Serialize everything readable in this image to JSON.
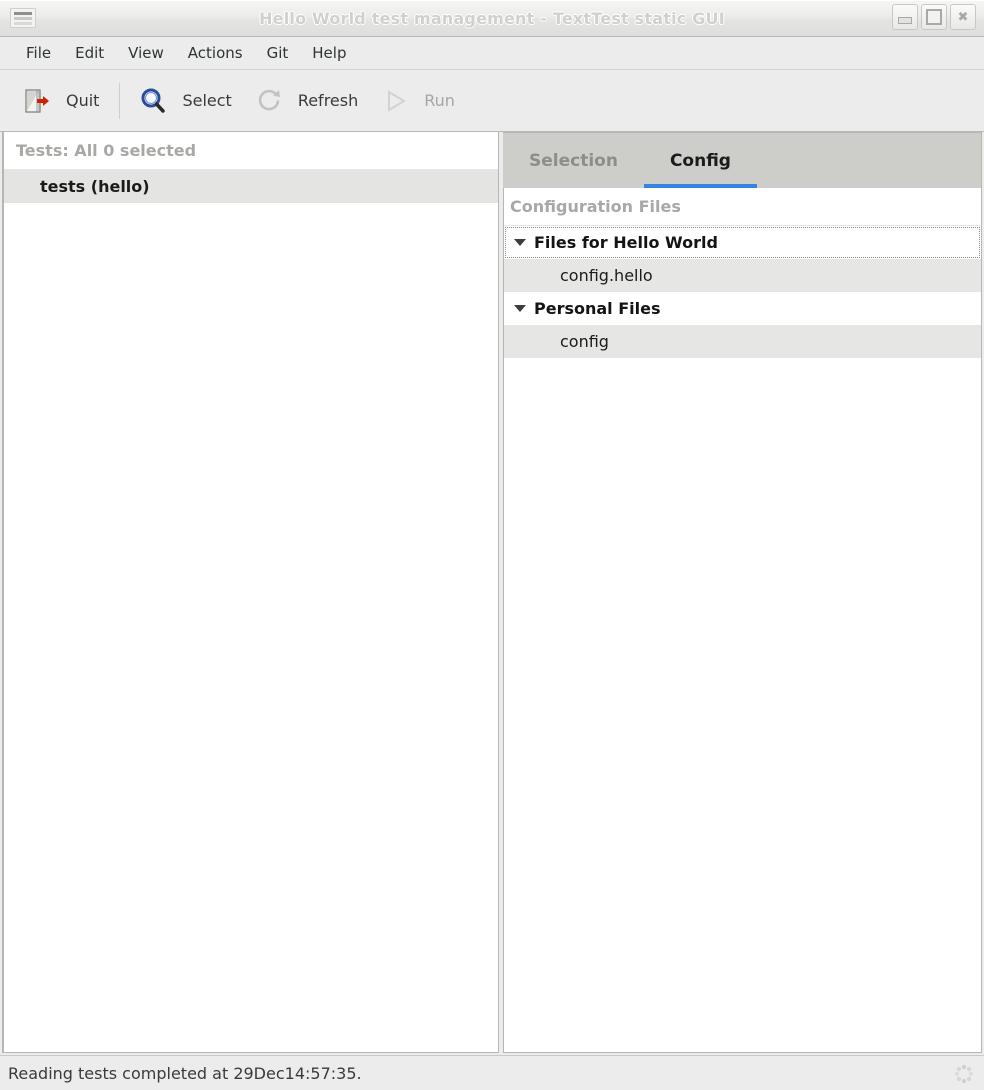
{
  "window": {
    "title": "Hello World test management - TextTest static GUI",
    "menu_icon": "window-menu-icon",
    "controls": {
      "minimize": "minimize-icon",
      "maximize": "maximize-icon",
      "close": "close-icon"
    }
  },
  "menubar": {
    "items": [
      {
        "label": "File"
      },
      {
        "label": "Edit"
      },
      {
        "label": "View"
      },
      {
        "label": "Actions"
      },
      {
        "label": "Git"
      },
      {
        "label": "Help"
      }
    ]
  },
  "toolbar": {
    "items": [
      {
        "label": "Quit",
        "icon": "quit-door-icon",
        "enabled": true
      },
      {
        "label": "Select",
        "icon": "magnifier-icon",
        "enabled": true
      },
      {
        "label": "Refresh",
        "icon": "refresh-circle-icon",
        "enabled": true
      },
      {
        "label": "Run",
        "icon": "play-triangle-icon",
        "enabled": false
      }
    ]
  },
  "left_panel": {
    "header": "Tests: All 0 selected",
    "rows": [
      {
        "label": "tests (hello)",
        "selected": true
      }
    ]
  },
  "right_panel": {
    "tabs": [
      {
        "label": "Selection",
        "active": false
      },
      {
        "label": "Config",
        "active": true
      }
    ],
    "section_title": "Configuration Files",
    "groups": [
      {
        "label": "Files for Hello World",
        "expanded": true,
        "focused": true,
        "files": [
          {
            "label": "config.hello"
          }
        ]
      },
      {
        "label": "Personal Files",
        "expanded": true,
        "focused": false,
        "files": [
          {
            "label": "config"
          }
        ]
      }
    ]
  },
  "statusbar": {
    "text": "Reading tests completed at 29Dec14:57:35.",
    "throbber": "spinner-dots-icon"
  },
  "colors": {
    "accent": "#3584e4",
    "chrome": "#ececec",
    "tabbar": "#cdcdca",
    "row_selected": "#e4e4e2",
    "muted_text": "#a8a8a5"
  }
}
